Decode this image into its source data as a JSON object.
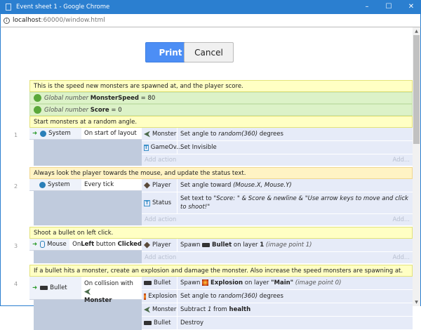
{
  "window": {
    "title": "Event sheet 1 - Google Chrome",
    "minimize": "–",
    "maximize": "☐",
    "close": "✕"
  },
  "address": {
    "host": "localhost",
    "path": ":60000/window.html"
  },
  "buttons": {
    "print": "Print",
    "cancel": "Cancel"
  },
  "sheet": {
    "comment0": "This is the speed new monsters are spawned at, and the player score.",
    "globals": [
      {
        "prefix": "Global number",
        "name": "MonsterSpeed",
        "eq": "= 80"
      },
      {
        "prefix": "Global number",
        "name": "Score",
        "eq": "= 0"
      }
    ],
    "add_action": "Add action",
    "add_more": "Add...",
    "events": [
      {
        "num": "1",
        "comment": "Start monsters at a random angle.",
        "cond_obj": "System",
        "cond": "On start of layout",
        "actions": [
          {
            "obj": "Monster",
            "a": "Set angle to ",
            "i": "random(360)",
            "b": " degrees"
          },
          {
            "obj": "GameOv...",
            "a": "Set Invisible"
          }
        ]
      },
      {
        "num": "2",
        "comment": "Always look the player towards the mouse, and update the status text.",
        "cond_obj": "System",
        "cond": "Every tick",
        "actions": [
          {
            "obj": "Player",
            "a": "Set angle toward ",
            "i": "(Mouse.X, Mouse.Y)"
          },
          {
            "obj": "Status",
            "a": "Set text to ",
            "i": "\"Score: \" & Score & newline & \"Use arrow keys to move and click to shoot!\""
          }
        ]
      },
      {
        "num": "3",
        "comment": "Shoot a bullet on left click.",
        "cond_obj": "Mouse",
        "cond_a": "On ",
        "cond_b1": "Left",
        "cond_c": " button ",
        "cond_b2": "Clicked",
        "actions": [
          {
            "obj": "Player",
            "a": "Spawn ",
            "b": "Bullet",
            "c": " on layer ",
            "d": "1",
            "i": " (image point 1)"
          }
        ]
      },
      {
        "num": "4",
        "comment": "If a bullet hits a monster, create an explosion and damage the monster. Also increase the speed monsters are spawning at.",
        "cond_obj": "Bullet",
        "cond_a": "On collision with",
        "cond_b": "Monster",
        "actions": [
          {
            "obj": "Bullet",
            "a": "Spawn ",
            "b": "Explosion",
            "c": " on layer ",
            "d": "\"Main\"",
            "i": " (image point 0)"
          },
          {
            "obj": "Explosion",
            "a": "Set angle to ",
            "i": "random(360)",
            "b": " degrees"
          },
          {
            "obj": "Monster",
            "a": "Subtract ",
            "i": "1",
            "b": " from ",
            "c": "health"
          },
          {
            "obj": "Bullet",
            "a": "Destroy"
          }
        ]
      }
    ]
  }
}
